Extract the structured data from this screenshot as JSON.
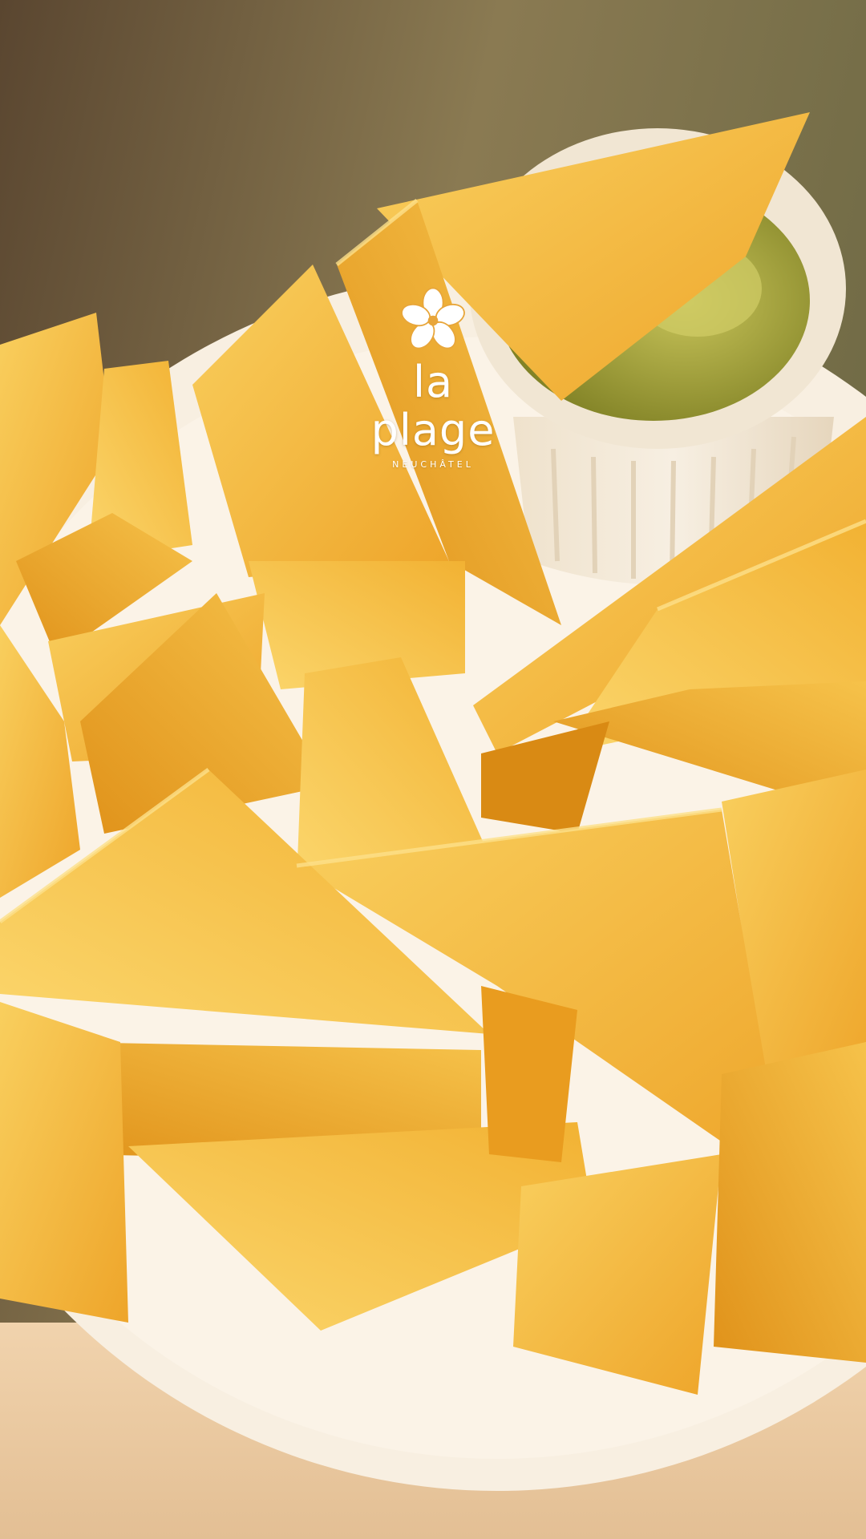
{
  "brand": {
    "name": "la plage",
    "location": "NEUCHÂTEL",
    "logo_icon": "flower-icon",
    "logo_color": "#ffffff"
  },
  "photo": {
    "colors": {
      "chips": "#f2b233",
      "chips_light": "#f8cd5c",
      "chips_shadow": "#d98a14",
      "plate": "#f6eee0",
      "ramekin": "#f2e9da",
      "guacamole": "#9a9a2c",
      "table": "#e9c9a4",
      "background": "#6b5a3e"
    }
  }
}
